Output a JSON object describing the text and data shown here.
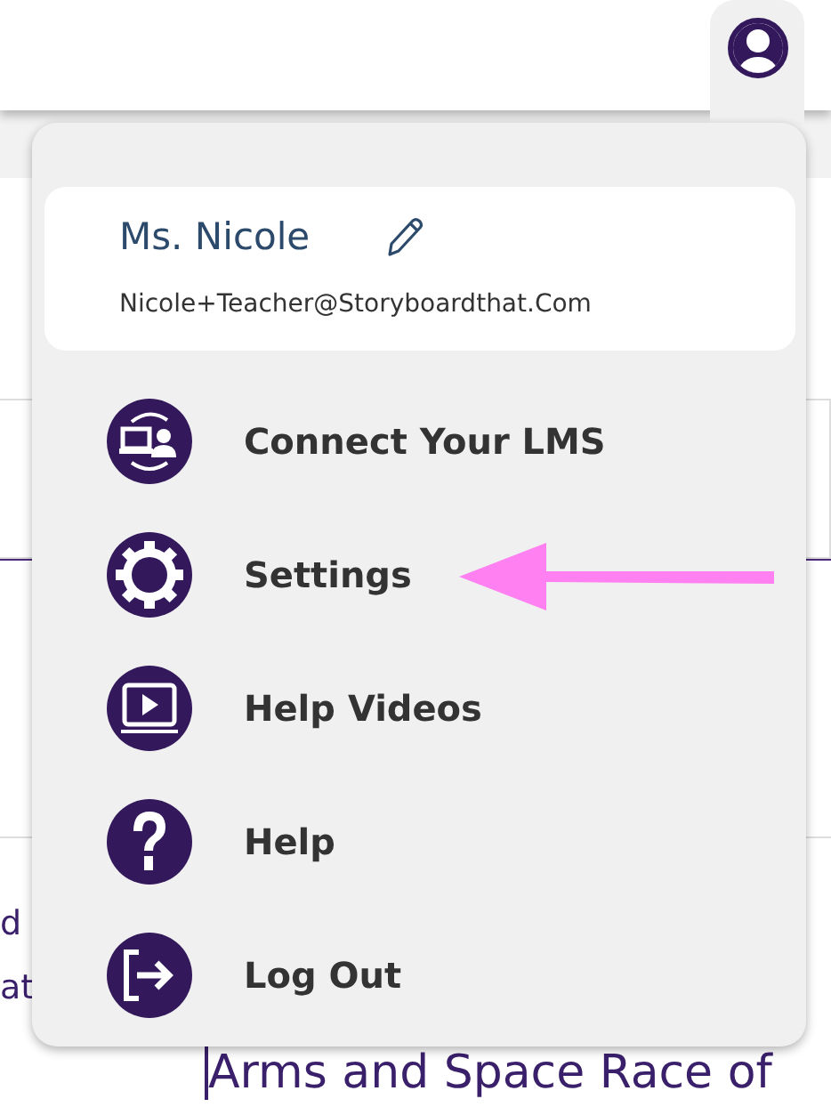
{
  "background": {
    "fragments": [
      {
        "text": "d"
      },
      {
        "text": "at"
      }
    ],
    "heading": "Arms and Space Race of"
  },
  "profile": {
    "name": "Ms. Nicole",
    "email": "Nicole+Teacher@Storyboardthat.Com"
  },
  "menu": [
    {
      "kind": "lms",
      "label": "Connect Your LMS",
      "pointed": false
    },
    {
      "kind": "settings",
      "label": "Settings",
      "pointed": true
    },
    {
      "kind": "videos",
      "label": "Help Videos",
      "pointed": false
    },
    {
      "kind": "help",
      "label": "Help",
      "pointed": false
    },
    {
      "kind": "logout",
      "label": "Log Out",
      "pointed": false
    }
  ]
}
